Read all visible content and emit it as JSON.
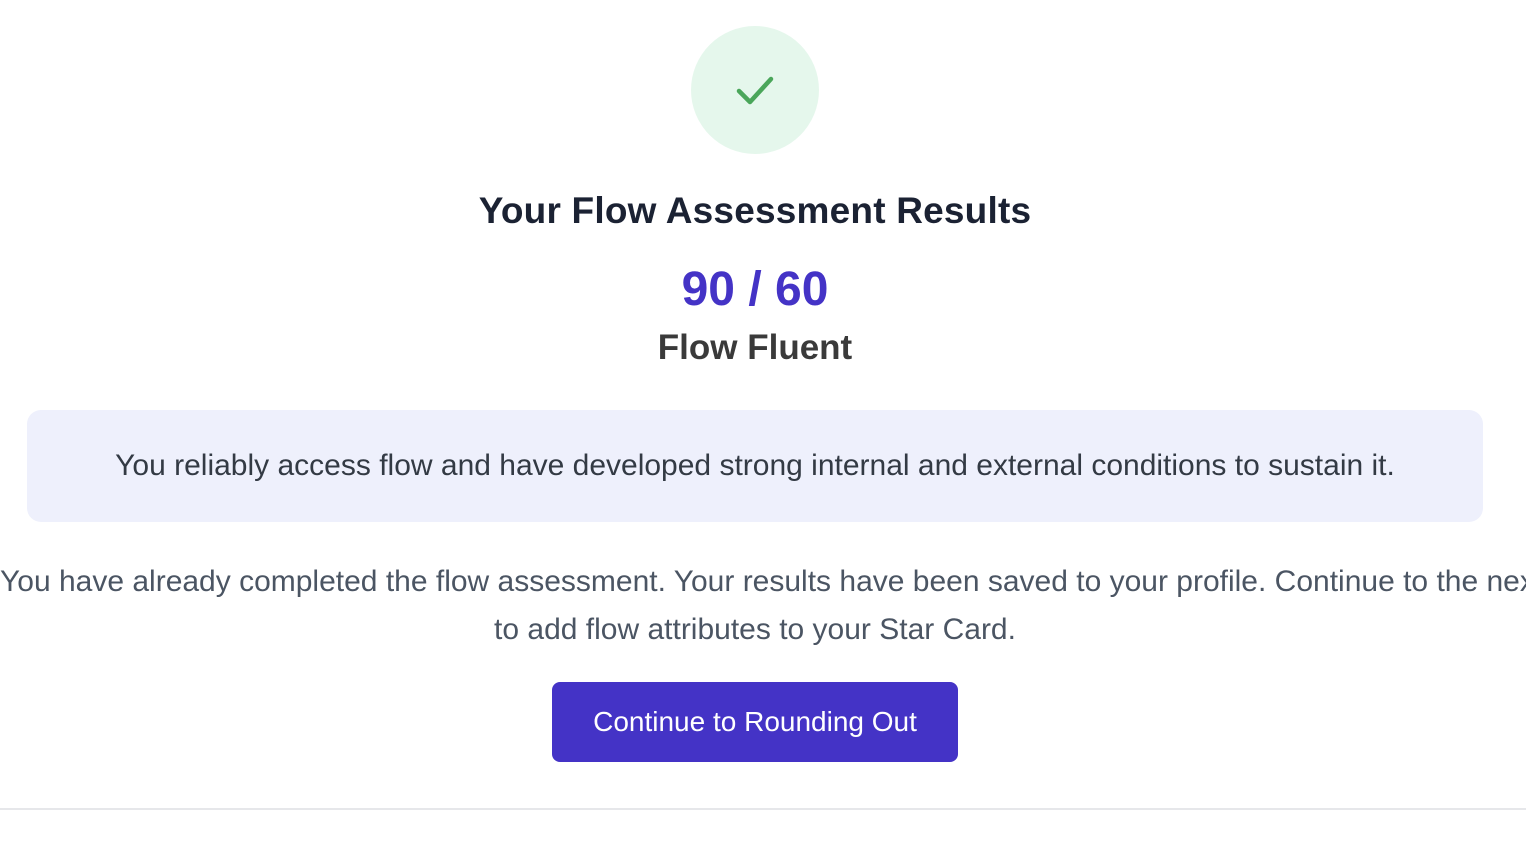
{
  "result": {
    "title": "Your Flow Assessment Results",
    "score": "90 / 60",
    "level": "Flow Fluent",
    "description": "You reliably access flow and have developed strong internal and external conditions to sustain it."
  },
  "info": {
    "line1": "You have already completed the flow assessment. Your results have been saved to your profile. Continue to the next step",
    "line2": "to add flow attributes to your Star Card."
  },
  "actions": {
    "continue_label": "Continue to Rounding Out"
  },
  "colors": {
    "accent": "#4433c6",
    "success": "#4aa65a",
    "success_bg": "#e5f7ec",
    "description_bg": "#eef0fc"
  },
  "icons": {
    "status": "checkmark-icon"
  }
}
